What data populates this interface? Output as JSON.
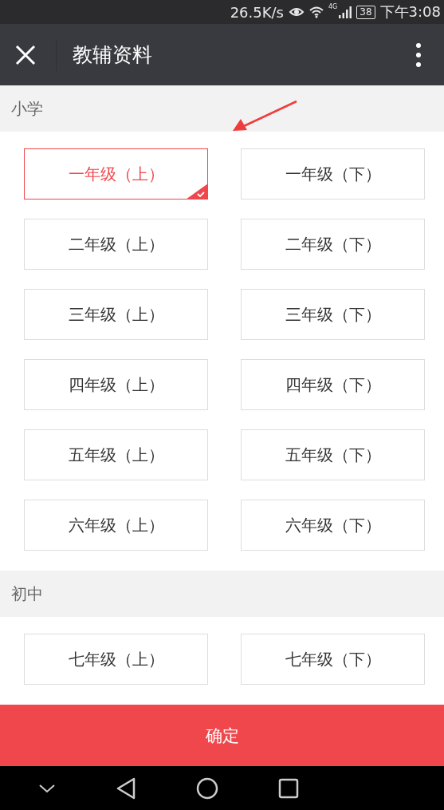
{
  "status_bar": {
    "speed": "26.5K/s",
    "network": "4G",
    "battery": "38",
    "time": "下午3:08"
  },
  "app_bar": {
    "title": "教辅资料"
  },
  "sections": [
    {
      "title": "小学",
      "items": [
        {
          "label": "一年级（上）",
          "selected": true
        },
        {
          "label": "一年级（下）",
          "selected": false
        },
        {
          "label": "二年级（上）",
          "selected": false
        },
        {
          "label": "二年级（下）",
          "selected": false
        },
        {
          "label": "三年级（上）",
          "selected": false
        },
        {
          "label": "三年级（下）",
          "selected": false
        },
        {
          "label": "四年级（上）",
          "selected": false
        },
        {
          "label": "四年级（下）",
          "selected": false
        },
        {
          "label": "五年级（上）",
          "selected": false
        },
        {
          "label": "五年级（下）",
          "selected": false
        },
        {
          "label": "六年级（上）",
          "selected": false
        },
        {
          "label": "六年级（下）",
          "selected": false
        }
      ]
    },
    {
      "title": "初中",
      "items": [
        {
          "label": "七年级（上）",
          "selected": false
        },
        {
          "label": "七年级（下）",
          "selected": false
        }
      ]
    }
  ],
  "confirm_button": "确定"
}
